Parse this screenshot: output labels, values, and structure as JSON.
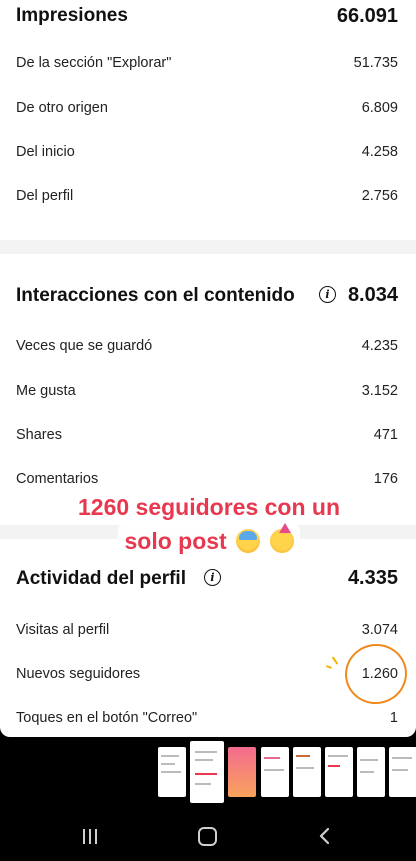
{
  "impressions": {
    "title": "Impresiones",
    "total": "66.091",
    "rows": [
      {
        "label": "De la sección \"Explorar\"",
        "value": "51.735"
      },
      {
        "label": "De otro origen",
        "value": "6.809"
      },
      {
        "label": "Del inicio",
        "value": "4.258"
      },
      {
        "label": "Del perfil",
        "value": "2.756"
      }
    ]
  },
  "interactions": {
    "title": "Interacciones con el contenido",
    "info_icon": "info-icon",
    "total": "8.034",
    "rows": [
      {
        "label": "Veces que se guardó",
        "value": "4.235"
      },
      {
        "label": "Me gusta",
        "value": "3.152"
      },
      {
        "label": "Shares",
        "value": "471"
      },
      {
        "label": "Comentarios",
        "value": "176"
      }
    ]
  },
  "profile_activity": {
    "title": "Actividad del perfil",
    "info_icon": "info-icon",
    "total": "4.335",
    "rows": [
      {
        "label": "Visitas al perfil",
        "value": "3.074"
      },
      {
        "label": "Nuevos seguidores",
        "value": "1.260"
      },
      {
        "label": "Toques en el botón \"Correo\"",
        "value": "1"
      }
    ]
  },
  "overlay": {
    "line1": "1260 seguidores con un",
    "line2": "solo post",
    "emojis": [
      "face-screaming-emoji",
      "partying-face-emoji"
    ],
    "color": "#e8384f"
  },
  "highlight_color": "#f08a1c",
  "filmstrip": {
    "thumbnail_count": 8,
    "active_index": 1
  },
  "navbar": {
    "icons": [
      "recents-icon",
      "home-icon",
      "back-icon"
    ]
  }
}
